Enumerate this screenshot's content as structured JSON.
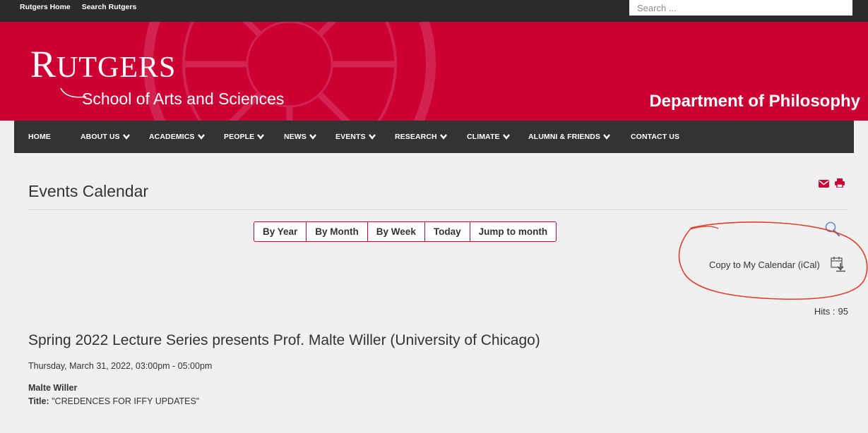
{
  "topbar": {
    "links": [
      "Rutgers Home",
      "Search Rutgers"
    ],
    "search_placeholder": "Search ..."
  },
  "banner": {
    "logo_first": "R",
    "logo_rest": "UTGERS",
    "school": "School of Arts and Sciences",
    "department": "Department of Philosophy",
    "color": "#cc0033"
  },
  "nav": [
    {
      "label": "HOME",
      "dropdown": false
    },
    {
      "label": "ABOUT US",
      "dropdown": true
    },
    {
      "label": "ACADEMICS",
      "dropdown": true
    },
    {
      "label": "PEOPLE",
      "dropdown": true
    },
    {
      "label": "NEWS",
      "dropdown": true
    },
    {
      "label": "EVENTS",
      "dropdown": true
    },
    {
      "label": "RESEARCH",
      "dropdown": true
    },
    {
      "label": "CLIMATE",
      "dropdown": true
    },
    {
      "label": "ALUMNI & FRIENDS",
      "dropdown": true
    },
    {
      "label": "CONTACT US",
      "dropdown": false
    }
  ],
  "page": {
    "title": "Events Calendar",
    "actions": [
      "email-icon",
      "print-icon"
    ]
  },
  "view_buttons": [
    "By Year",
    "By Month",
    "By Week",
    "Today",
    "Jump to month"
  ],
  "tools": {
    "search_icon": "magnifier-icon",
    "ical_label": "Copy to My Calendar (iCal)",
    "ical_icon": "calendar-download-icon"
  },
  "hits": {
    "label": "Hits :",
    "value": "95"
  },
  "event": {
    "title": "Spring 2022 Lecture Series presents Prof. Malte Willer (University of Chicago)",
    "date": "Thursday, March 31, 2022, 03:00pm - 05:00pm",
    "speaker": "Malte Willer",
    "talk_label": "Title:",
    "talk_title": " \"CREDENCES FOR IFFY UPDATES\""
  }
}
